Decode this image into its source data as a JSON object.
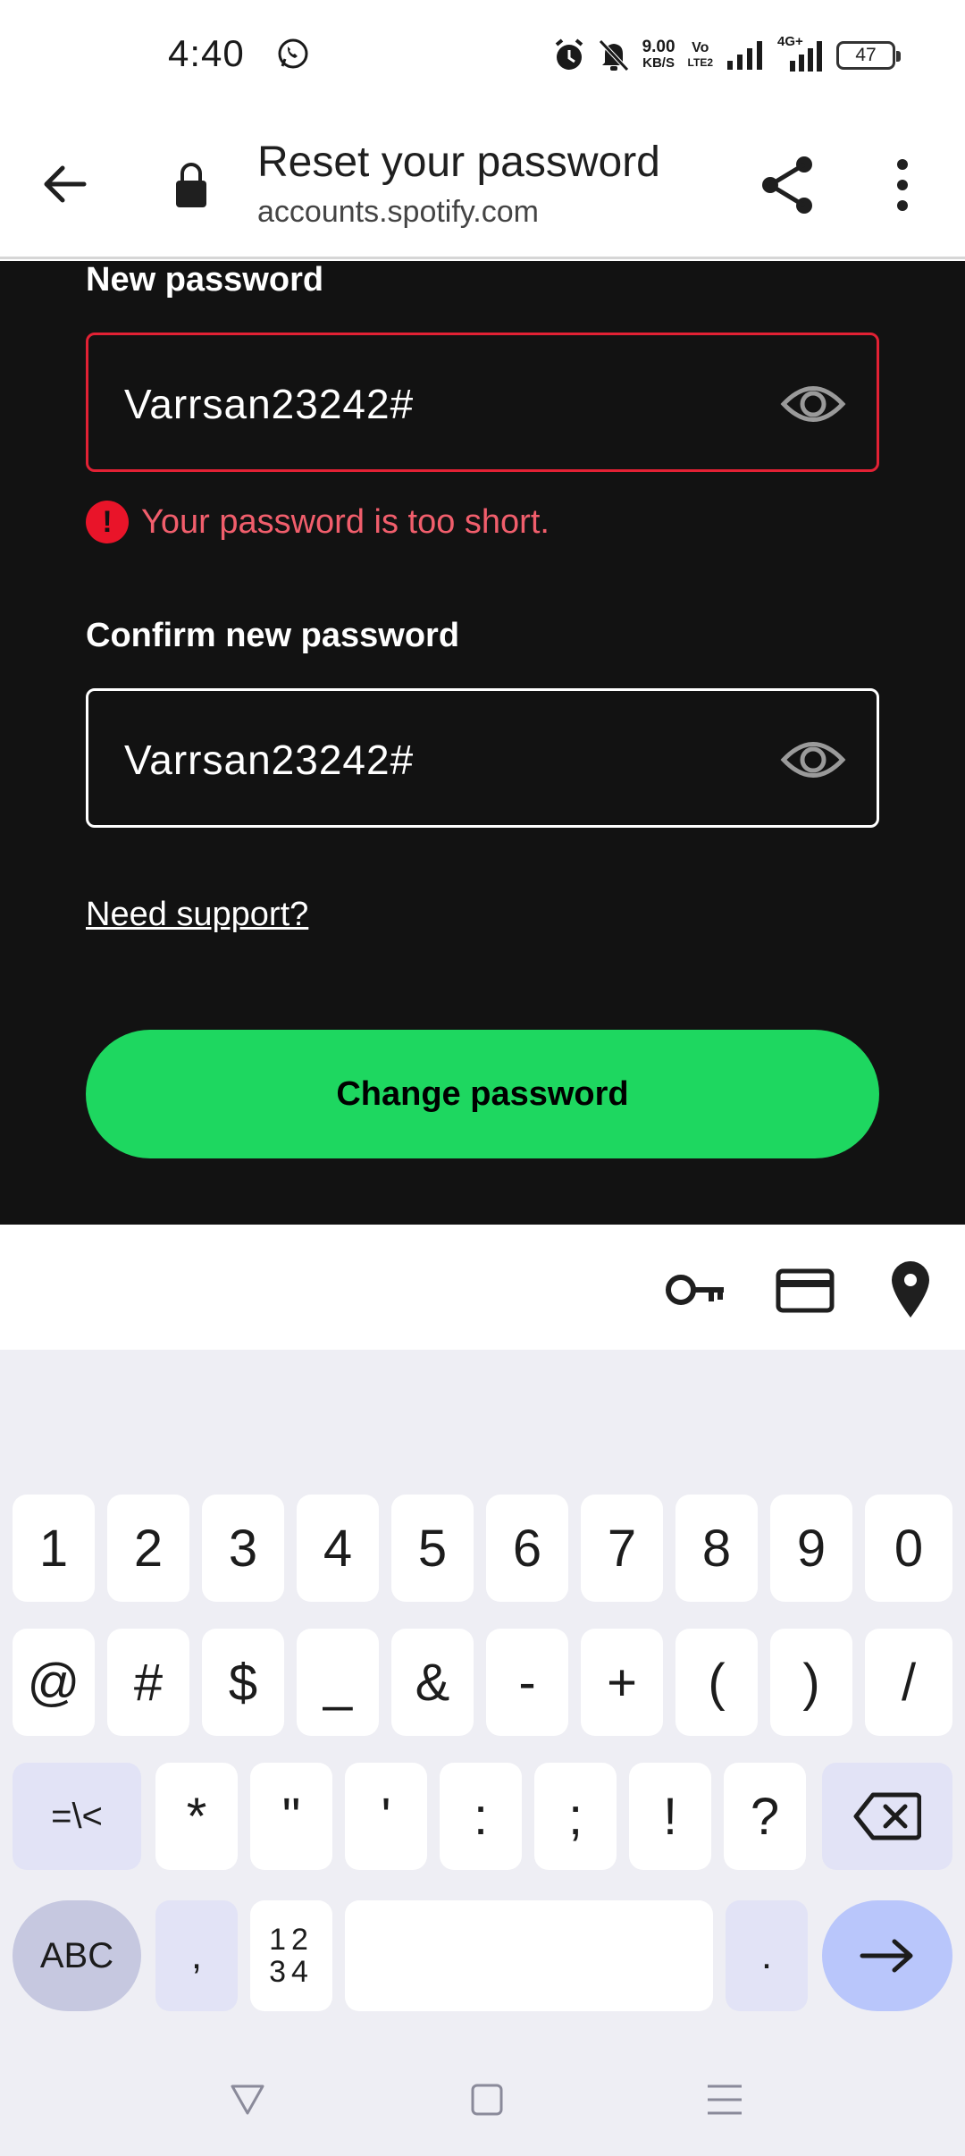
{
  "status_bar": {
    "time": "4:40",
    "net_speed_value": "9.00",
    "net_speed_unit": "KB/S",
    "volte_top": "Vo",
    "volte_bottom": "LTE2",
    "network_badge": "4G+",
    "battery": "47"
  },
  "browser": {
    "page_title": "Reset your password",
    "url": "accounts.spotify.com"
  },
  "form": {
    "new_password_label": "New password",
    "new_password_value": "Varrsan23242#",
    "error_message": "Your password is too short.",
    "confirm_password_label": "Confirm new password",
    "confirm_password_value": "Varrsan23242#",
    "support_link": "Need support?",
    "submit_button": "Change password"
  },
  "keyboard": {
    "row1": [
      "1",
      "2",
      "3",
      "4",
      "5",
      "6",
      "7",
      "8",
      "9",
      "0"
    ],
    "row2": [
      "@",
      "#",
      "$",
      "_",
      "&",
      "-",
      "+",
      "(",
      ")",
      "/"
    ],
    "row3_symbols": [
      "*",
      "\"",
      "'",
      ":",
      ";",
      "!",
      "?"
    ],
    "symbols_toggle": "=\\<",
    "abc_key": "ABC",
    "comma_key": ",",
    "numpad_key_top": "12",
    "numpad_key_bottom": "34",
    "period_key": "."
  },
  "colors": {
    "accent_green": "#1ed760",
    "error_red": "#e22134",
    "background_dark": "#121212"
  }
}
